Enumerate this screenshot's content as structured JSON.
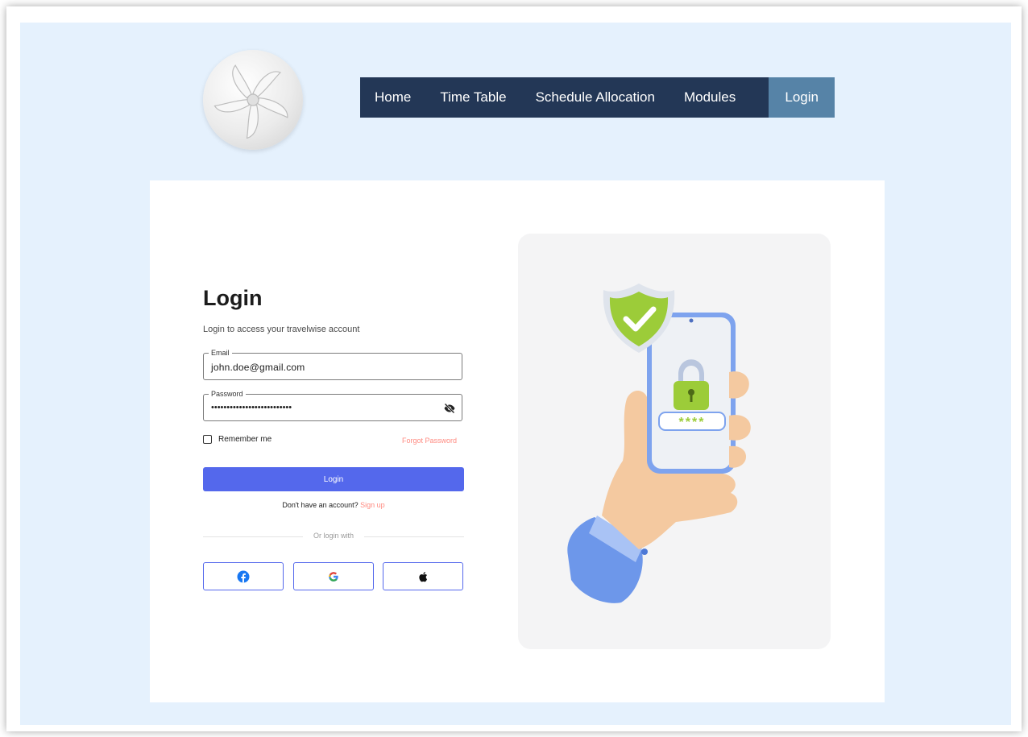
{
  "nav": {
    "items": [
      "Home",
      "Time Table",
      "Schedule Allocation",
      "Modules"
    ],
    "active": "Login"
  },
  "login": {
    "title": "Login",
    "subtitle": "Login to access your travelwise  account",
    "email": {
      "label": "Email",
      "value": "john.doe@gmail.com"
    },
    "password": {
      "label": "Password",
      "value": "••••••••••••••••••••••••••"
    },
    "remember_label": "Remember me",
    "forgot_label": "Forgot Password",
    "button_label": "Login",
    "no_account": "Don't have an account?",
    "signup_label": "Sign up",
    "or_login_with": "Or login with"
  },
  "social": [
    "facebook-icon",
    "google-icon",
    "apple-icon"
  ],
  "colors": {
    "nav_bg": "#233756",
    "nav_active": "#5683a7",
    "primary": "#5468ec",
    "accent": "#ff8a80",
    "page_bg": "#e5f1fd"
  }
}
